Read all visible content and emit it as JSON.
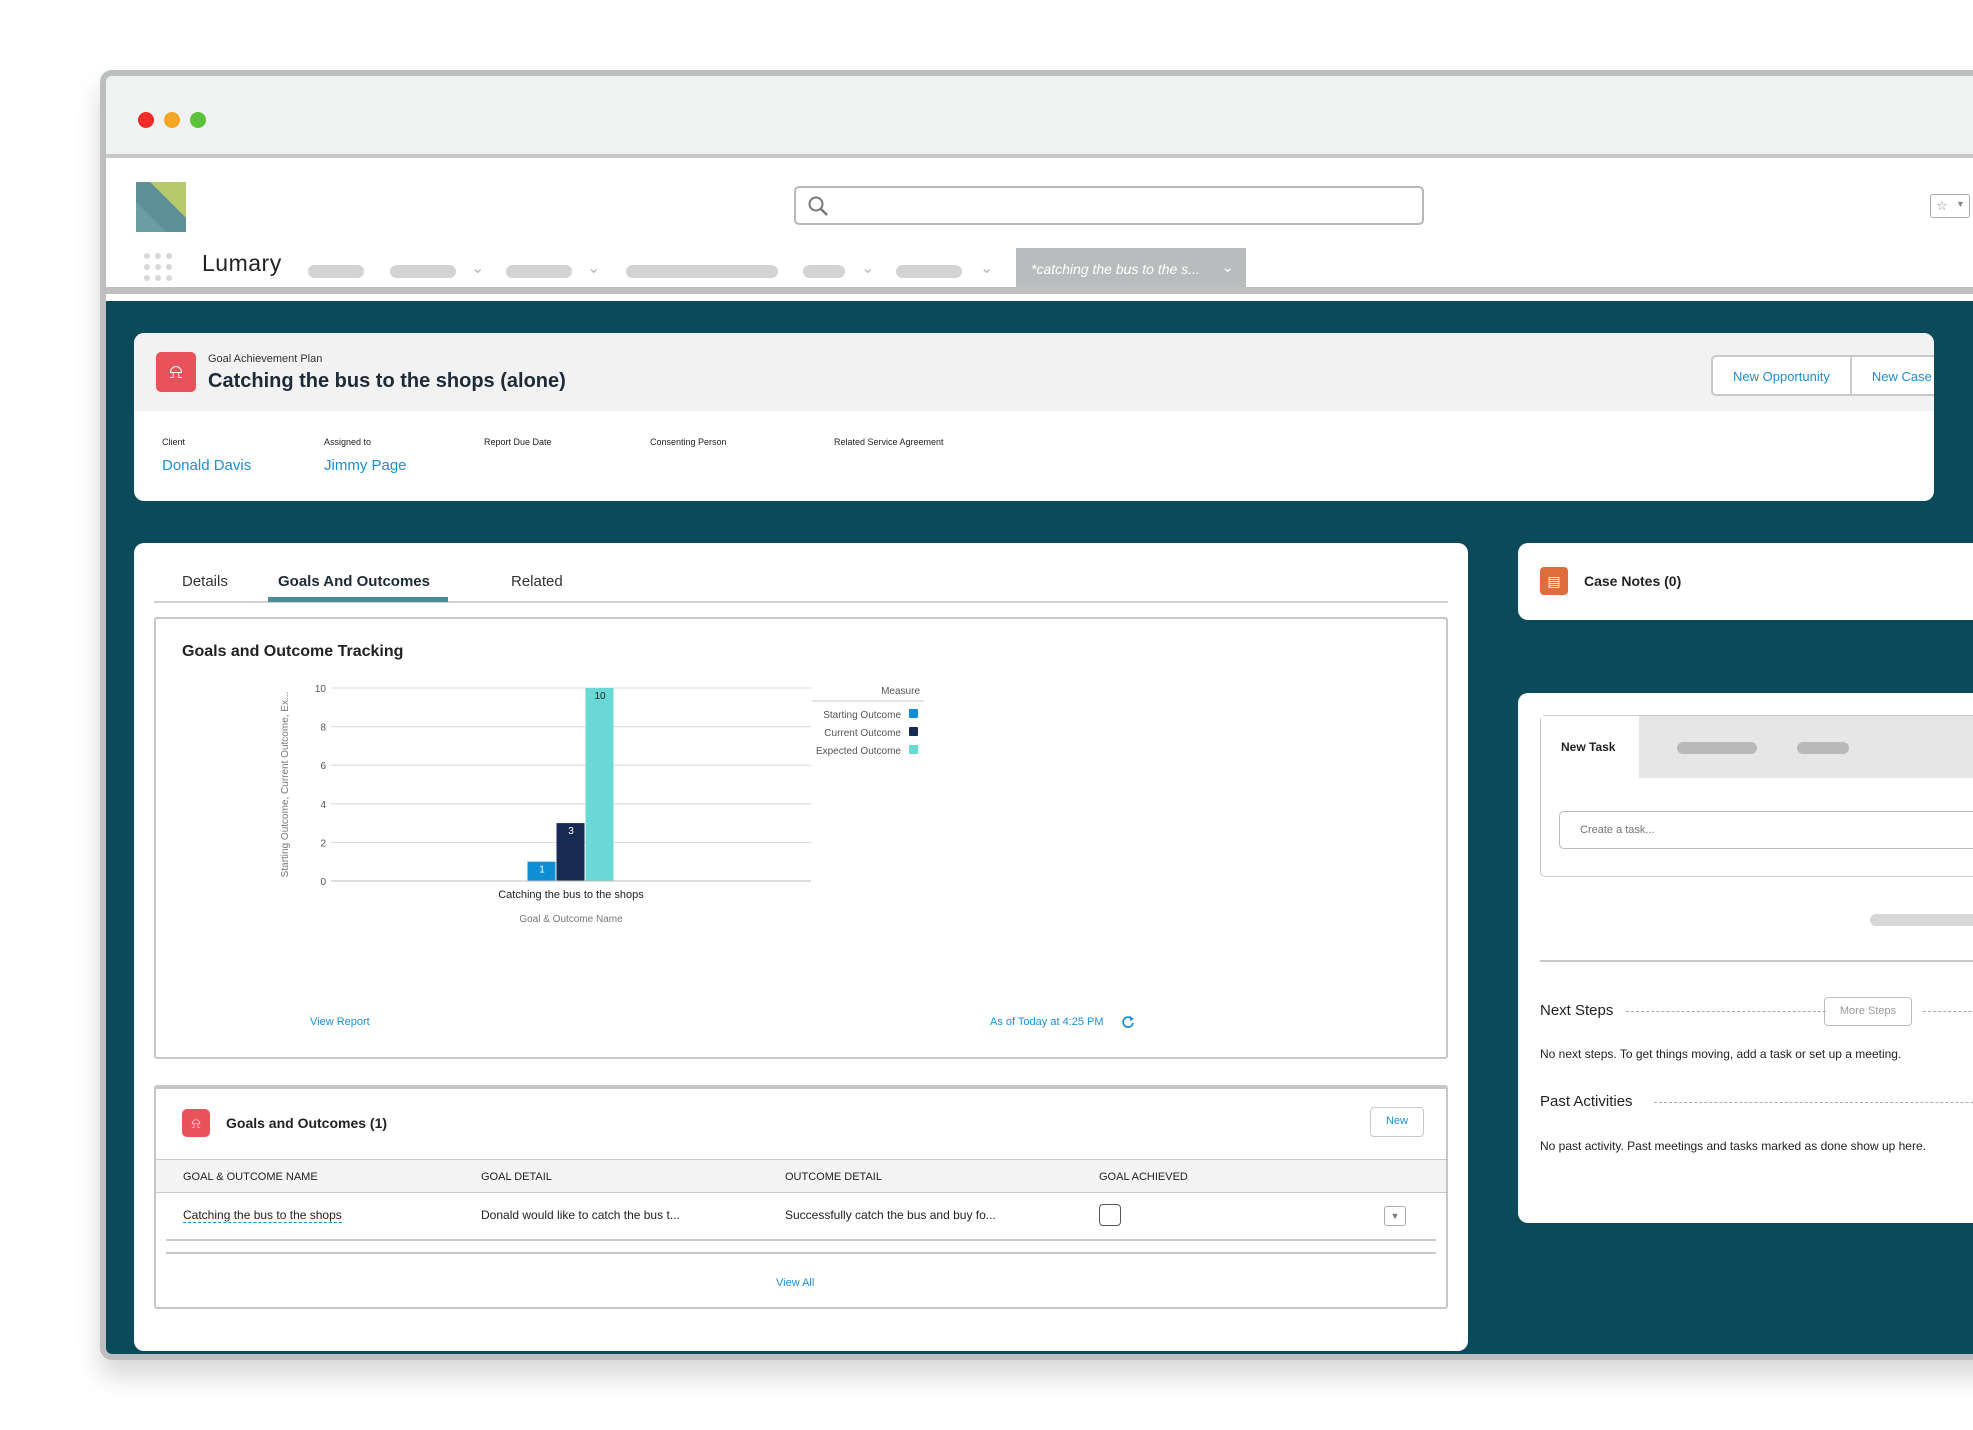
{
  "app": {
    "name": "Lumary",
    "active_tab": "*catching the bus to the s...",
    "brand": {
      "teal": "#6a9ea3",
      "green": "#b6c96b"
    }
  },
  "record": {
    "type": "Goal Achievement Plan",
    "title": "Catching the bus to the shops (alone)",
    "buttons": [
      "New Opportunity",
      "New Case"
    ],
    "fields": [
      {
        "label": "Client",
        "value": "Donald Davis"
      },
      {
        "label": "Assigned to",
        "value": "Jimmy Page"
      },
      {
        "label": "Report Due Date",
        "value": ""
      },
      {
        "label": "Consenting Person",
        "value": ""
      },
      {
        "label": "Related Service Agreement",
        "value": ""
      }
    ]
  },
  "tabs": {
    "details": "Details",
    "goals": "Goals And Outcomes",
    "related": "Related"
  },
  "chart_panel": {
    "title": "Goals and Outcome Tracking",
    "view_report": "View Report",
    "timestamp": "As of Today at 4:25 PM"
  },
  "chart_data": {
    "type": "bar",
    "categories": [
      "Catching the bus to the shops"
    ],
    "series": [
      {
        "name": "Starting Outcome",
        "values": [
          1
        ],
        "color": "#0e8fd3"
      },
      {
        "name": "Current Outcome",
        "values": [
          3
        ],
        "color": "#172b53"
      },
      {
        "name": "Expected Outcome",
        "values": [
          10
        ],
        "color": "#6ad9d5"
      }
    ],
    "xlabel": "Goal & Outcome Name",
    "ylabel": "Starting Outcome, Current Outcome, Ex...",
    "yticks": [
      0,
      2,
      4,
      6,
      8,
      10
    ],
    "ylim": [
      0,
      10
    ],
    "legend_title": "Measure",
    "legend_position": "top-right",
    "grid": true
  },
  "goals_list": {
    "title": "Goals and Outcomes (1)",
    "new_label": "New",
    "columns": [
      "GOAL & OUTCOME NAME",
      "GOAL DETAIL",
      "OUTCOME DETAIL",
      "GOAL ACHIEVED"
    ],
    "rows": [
      {
        "name": "Catching the bus to the shops",
        "goal_detail": "Donald would like to catch the bus t...",
        "outcome_detail": "Successfully catch the bus and buy fo..."
      }
    ],
    "view_all": "View All"
  },
  "side": {
    "case_notes": "Case Notes (0)",
    "new_task": "New Task",
    "task_placeholder": "Create a task...",
    "next_steps": "Next Steps",
    "more_steps": "More Steps",
    "next_steps_empty": "No next steps. To get things moving, add a task or set up a meeting.",
    "past_activities": "Past Activities",
    "past_empty": "No past activity. Past meetings and tasks marked as done show up here."
  }
}
